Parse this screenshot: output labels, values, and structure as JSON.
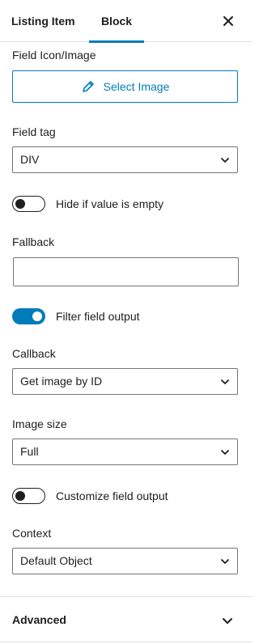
{
  "tabs": [
    {
      "label": "Listing Item",
      "active": false
    },
    {
      "label": "Block",
      "active": true
    }
  ],
  "accent_color": "#007cba",
  "icons": {
    "close": "close-icon",
    "pencil": "pencil-icon",
    "chevron": "chevron-down-icon"
  },
  "field_icon": {
    "label": "Field Icon/Image",
    "button_label": "Select Image"
  },
  "field_tag": {
    "label": "Field tag",
    "value": "DIV"
  },
  "hide_if_empty": {
    "label": "Hide if value is empty",
    "checked": false
  },
  "fallback": {
    "label": "Fallback",
    "value": ""
  },
  "filter_output": {
    "label": "Filter field output",
    "checked": true
  },
  "callback": {
    "label": "Callback",
    "value": "Get image by ID"
  },
  "image_size": {
    "label": "Image size",
    "value": "Full"
  },
  "customize_output": {
    "label": "Customize field output",
    "checked": false
  },
  "context": {
    "label": "Context",
    "value": "Default Object"
  },
  "advanced": {
    "label": "Advanced"
  }
}
